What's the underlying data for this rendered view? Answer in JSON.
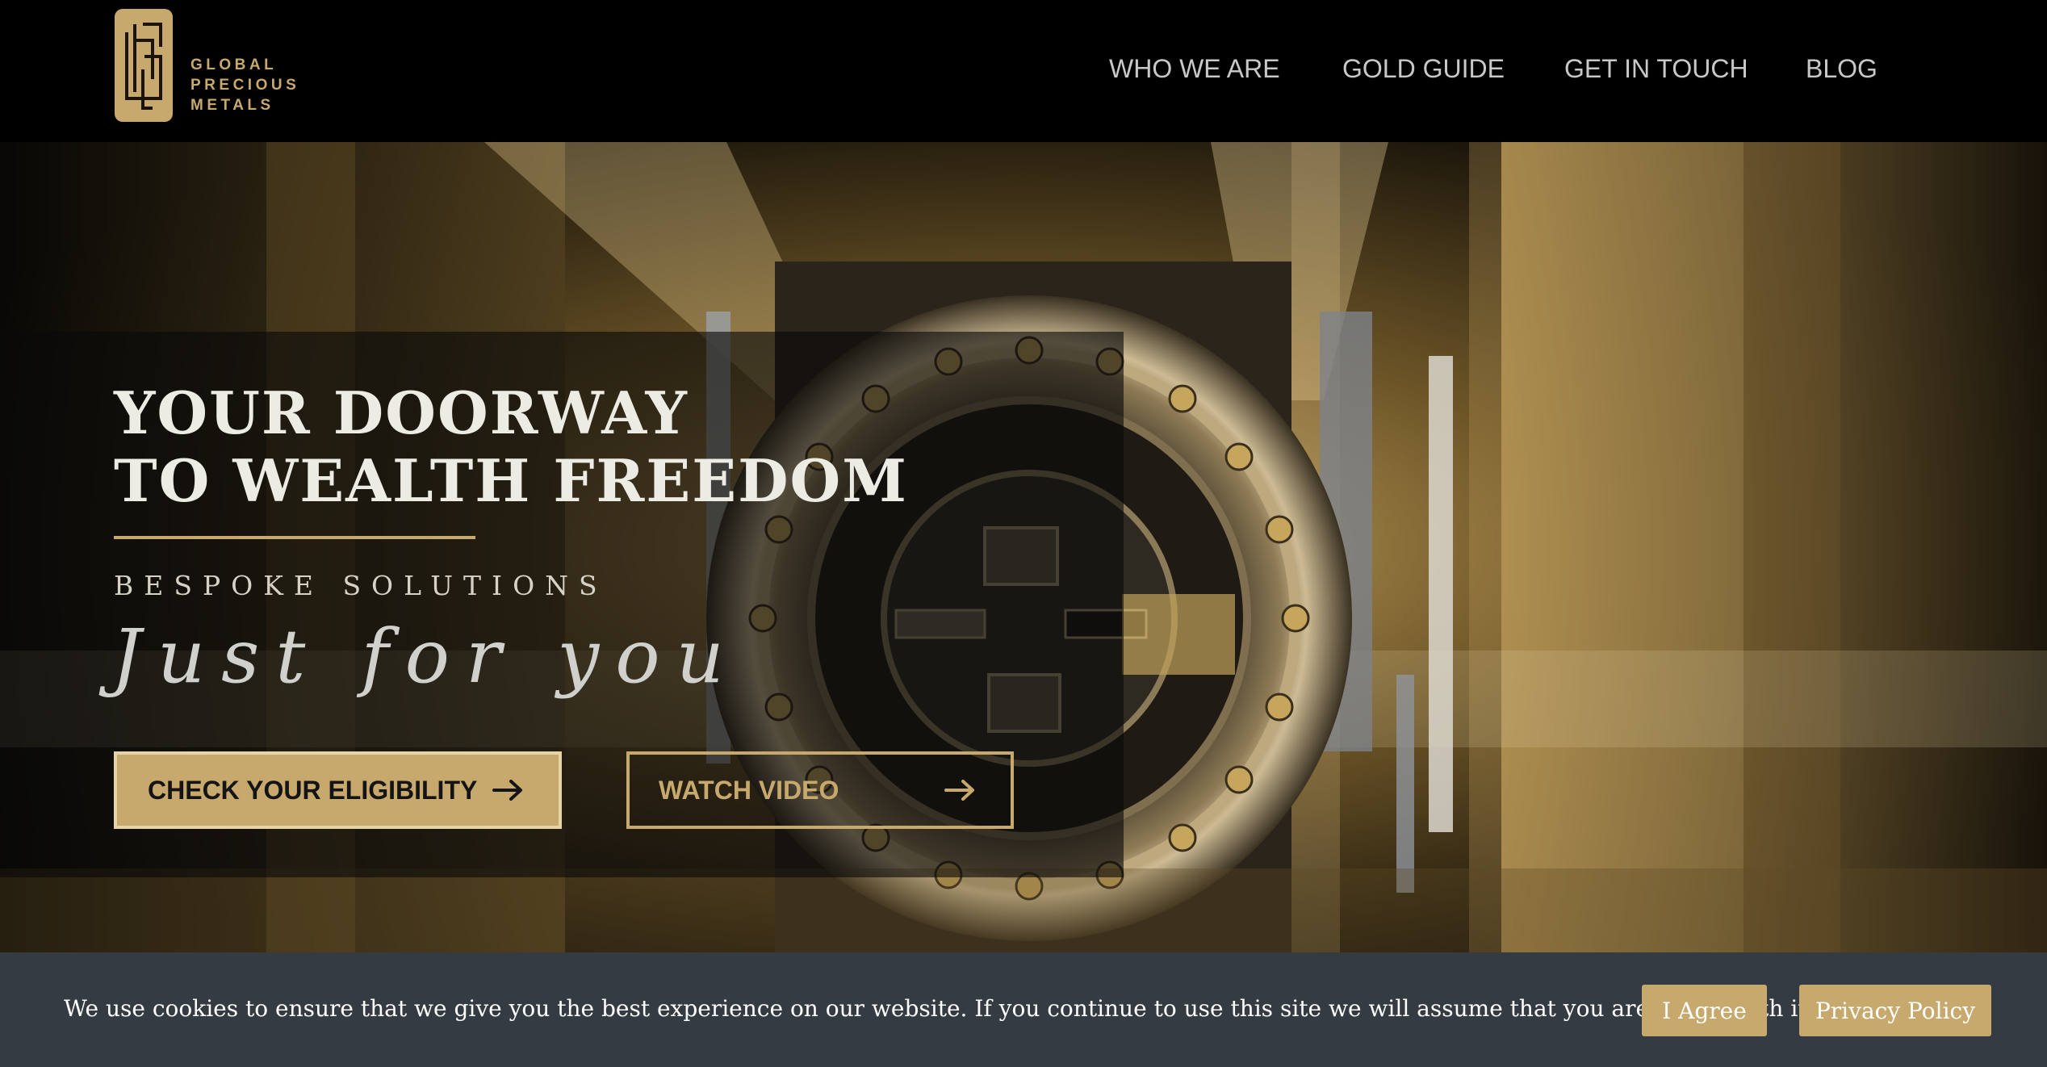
{
  "brand": {
    "name_lines": [
      "GLOBAL",
      "PRECIOUS",
      "METALS"
    ],
    "accent_color": "#c7a96d"
  },
  "nav": {
    "items": [
      "WHO WE ARE",
      "GOLD GUIDE",
      "GET IN TOUCH",
      "BLOG"
    ]
  },
  "hero": {
    "headline_lines": [
      "YOUR DOORWAY",
      "TO WEALTH FREEDOM"
    ],
    "subtitle": "BESPOKE SOLUTIONS",
    "script_text": "Just for you",
    "primary_button": {
      "label": "CHECK YOUR ELIGIBILITY",
      "icon": "arrow-right-icon"
    },
    "secondary_button": {
      "label": "WATCH VIDEO",
      "icon": "arrow-right-icon"
    }
  },
  "cookie_bar": {
    "message": "We use cookies to ensure that we give you the best experience on our website. If you continue to use this site we will assume that you are happy with it.",
    "agree_label": "I Agree",
    "privacy_label": "Privacy Policy"
  }
}
